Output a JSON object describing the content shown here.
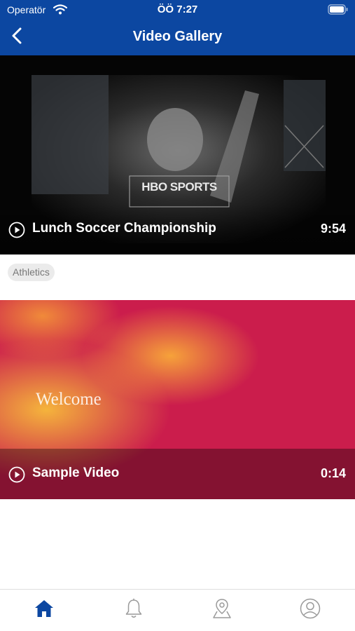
{
  "status_bar": {
    "carrier": "Operatör",
    "time": "ÖÖ 7:27"
  },
  "header": {
    "title": "Video Gallery"
  },
  "videos": [
    {
      "title": "Lunch Soccer Championship",
      "duration": "9:54",
      "tag": "Athletics",
      "thumbnail_text": "HBO SPORTS"
    },
    {
      "title": "Sample Video",
      "duration": "0:14",
      "thumbnail_text": "Welcome"
    }
  ],
  "tab_bar": {
    "items": [
      "home-icon",
      "bell-icon",
      "map-pin-icon",
      "user-icon"
    ],
    "active_index": 0
  },
  "colors": {
    "header": "#0c47a1",
    "active_tab": "#0c47a1",
    "inactive_tab": "#9a9a9a"
  }
}
